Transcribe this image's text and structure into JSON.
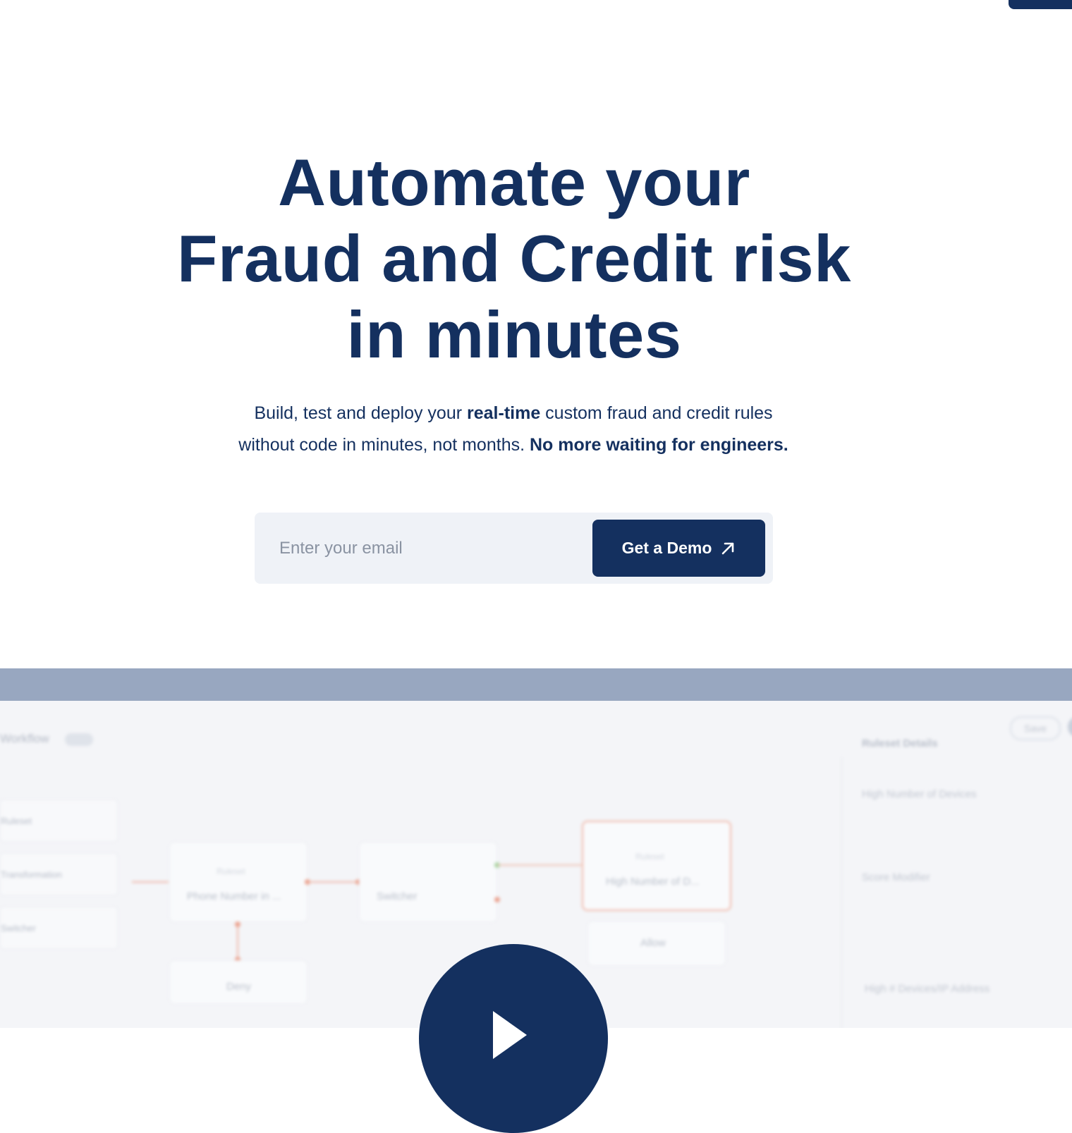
{
  "hero": {
    "title_line1": "Automate your",
    "title_line2": "Fraud and Credit risk",
    "title_line3": "in minutes",
    "sub_part1": "Build, test and deploy your ",
    "sub_bold1": "real-time",
    "sub_part2": " custom fraud and credit rules",
    "sub_part3": "without code in minutes, not months. ",
    "sub_bold2": "No more waiting for engineers."
  },
  "form": {
    "email_placeholder": "Enter your email",
    "button_label": "Get a Demo"
  },
  "preview": {
    "workflow_title": "Workflow",
    "save_label": "Save",
    "sidebar": [
      "Ruleset",
      "Transformation",
      "Switcher"
    ],
    "node_ruleset_sub": "Ruleset",
    "node_phone": "Phone Number in ...",
    "node_switcher": "Switcher",
    "node_high_sub": "Ruleset",
    "node_high": "High Number of D...",
    "node_allow": "Allow",
    "node_deny": "Deny",
    "panel_title": "Ruleset Details",
    "panel_rule_name": "High Number of Devices",
    "panel_score": "Score Modifier",
    "panel_bottom": "High # Devices/IP Address"
  },
  "colors": {
    "brand": "#14305f",
    "form_bg": "#eff2f7",
    "preview_bar": "#98a7c0"
  }
}
